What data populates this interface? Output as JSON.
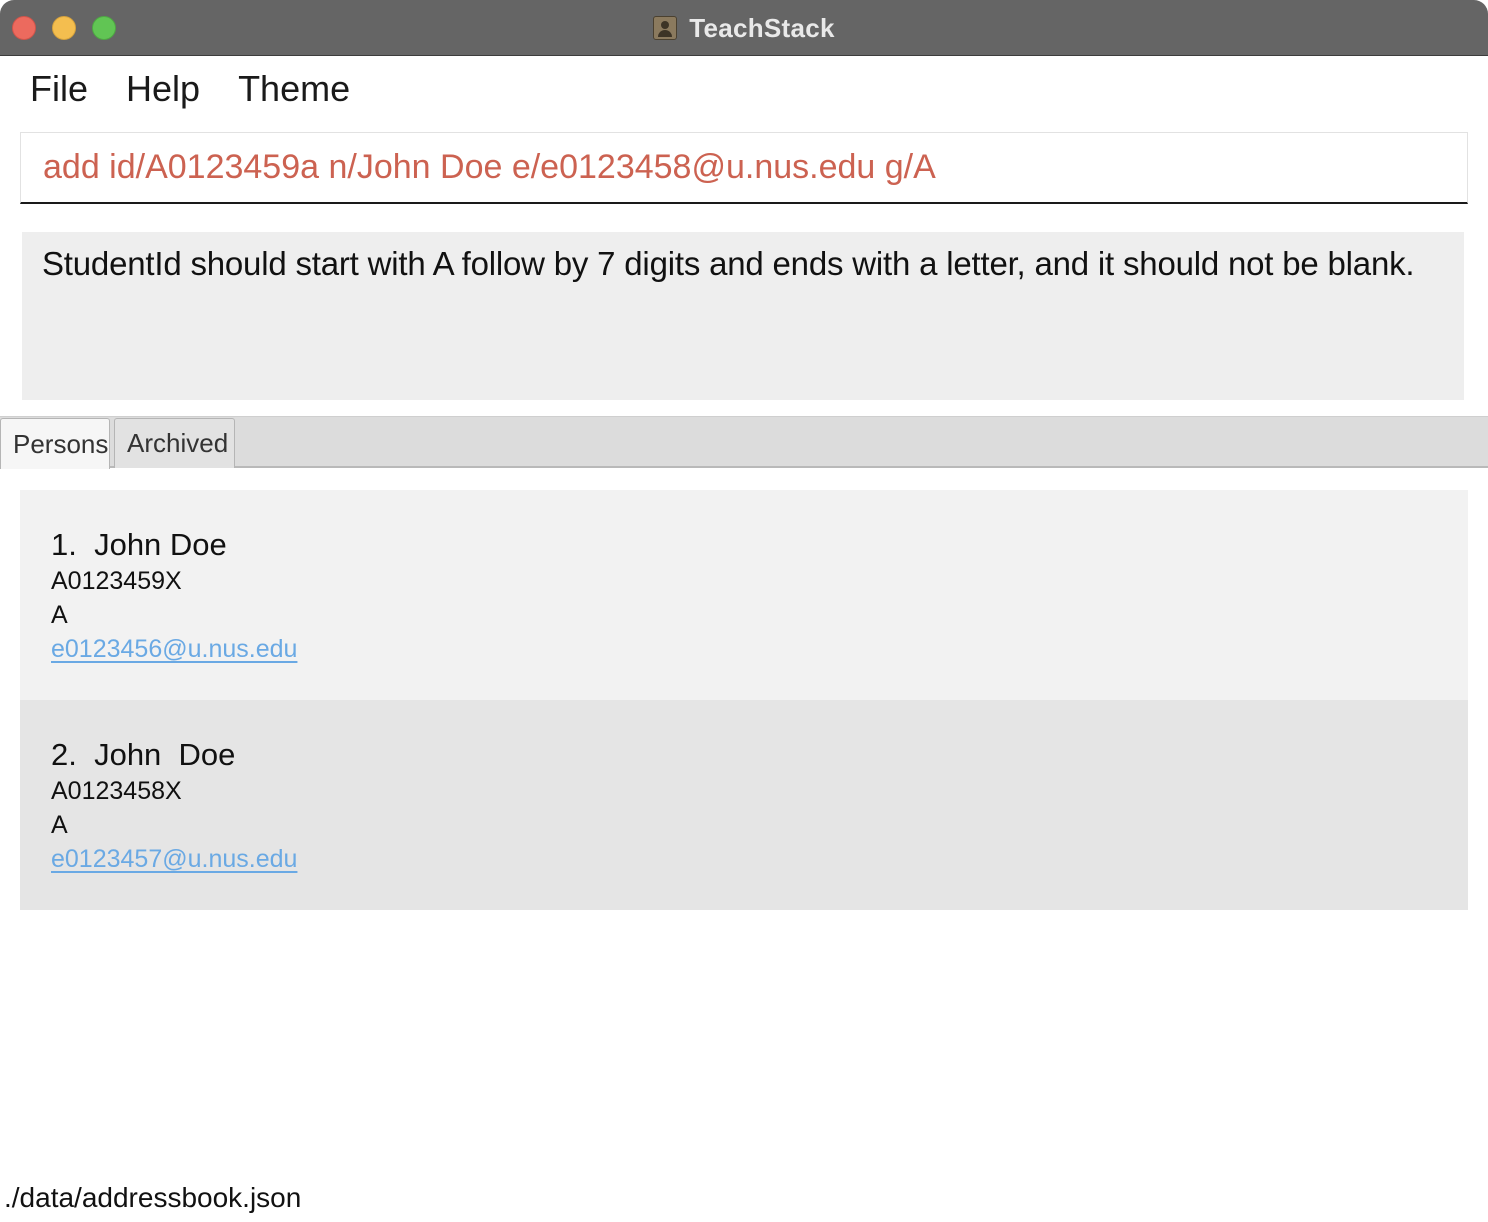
{
  "window": {
    "title": "TeachStack"
  },
  "menu": {
    "items": [
      "File",
      "Help",
      "Theme"
    ]
  },
  "command": {
    "value": "add id/A0123459a n/John Doe e/e0123458@u.nus.edu g/A",
    "color": "#cc6251"
  },
  "result": {
    "message": "StudentId should start with A follow by 7 digits and ends with a letter, and it should not be blank."
  },
  "tabs": [
    {
      "label": "Persons",
      "active": true
    },
    {
      "label": "Archived",
      "active": false
    }
  ],
  "persons": [
    {
      "title": "1.  John Doe",
      "student_id": "A0123459X",
      "grade": "A",
      "email": "e0123456@u.nus.edu"
    },
    {
      "title": "2.  John  Doe",
      "student_id": "A0123458X",
      "grade": "A",
      "email": "e0123457@u.nus.edu"
    }
  ],
  "status": {
    "path": "./data/addressbook.json"
  },
  "colors": {
    "titlebar": "#656565",
    "close": "#ec6a5e",
    "minimize": "#f4be4f",
    "maximize": "#61c554",
    "link": "#6aa9e4"
  },
  "icons": {
    "app": "contact-book-icon"
  }
}
